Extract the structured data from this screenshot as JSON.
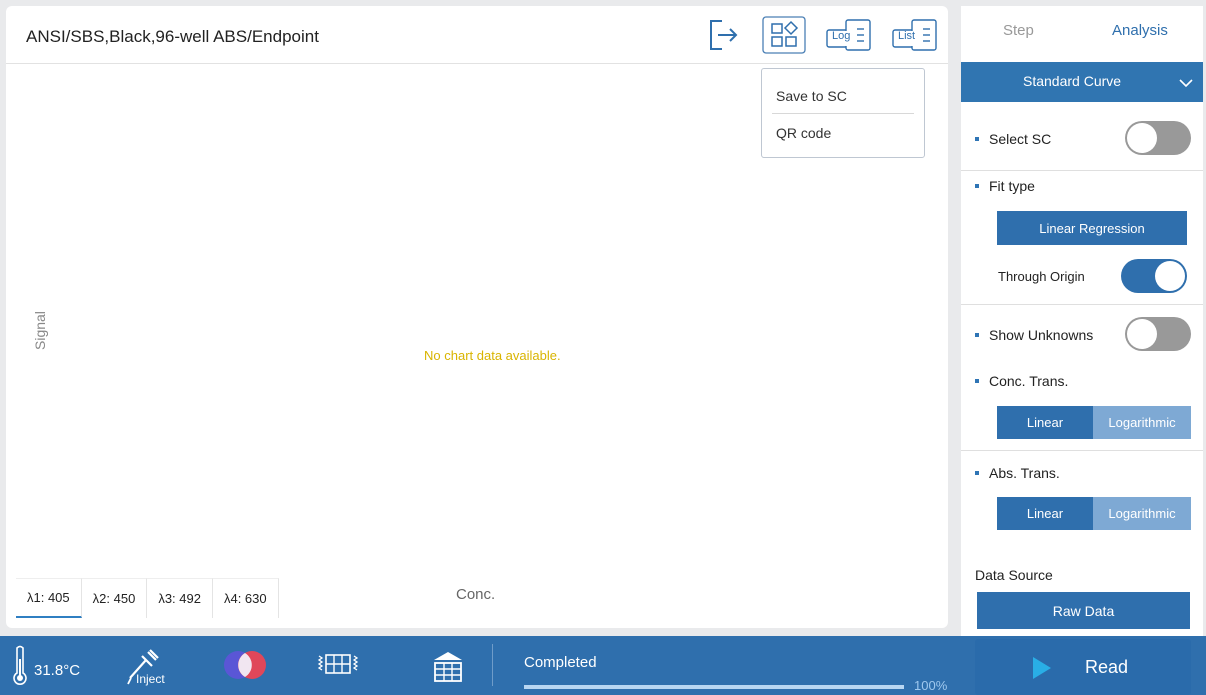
{
  "header": {
    "plate_title": "ANSI/SBS,Black,96-well   ABS/Endpoint",
    "log_label": "Log",
    "list_label": "List"
  },
  "dropdown": {
    "items": [
      "Save to SC",
      "QR code"
    ]
  },
  "chart": {
    "empty_message": "No chart data available.",
    "y_axis_label": "Signal",
    "x_axis_label": "Conc."
  },
  "wavelength_tabs": [
    "λ1: 405",
    "λ2: 450",
    "λ3: 492",
    "λ4: 630"
  ],
  "right_panel": {
    "tabs": [
      "Step",
      "Analysis"
    ],
    "section_title": "Standard Curve",
    "select_sc_label": "Select SC",
    "select_sc_on": false,
    "fit_type_label": "Fit type",
    "fit_type_value": "Linear Regression",
    "through_origin_label": "Through Origin",
    "through_origin_on": true,
    "show_unknowns_label": "Show Unknowns",
    "show_unknowns_on": false,
    "conc_trans_label": "Conc. Trans.",
    "conc_trans_options": [
      "Linear",
      "Logarithmic"
    ],
    "abs_trans_label": "Abs. Trans.",
    "abs_trans_options": [
      "Linear",
      "Logarithmic"
    ],
    "data_source_label": "Data Source",
    "data_source_value": "Raw Data"
  },
  "bottom_bar": {
    "temperature": "31.8°C",
    "inject_label": "Inject",
    "status": "Completed",
    "progress_percent": 100,
    "progress_text": "100%",
    "read_label": "Read"
  },
  "colors": {
    "accent": "#2f6fad",
    "empty_message": "#d9b400",
    "toggle_off": "#999999"
  }
}
